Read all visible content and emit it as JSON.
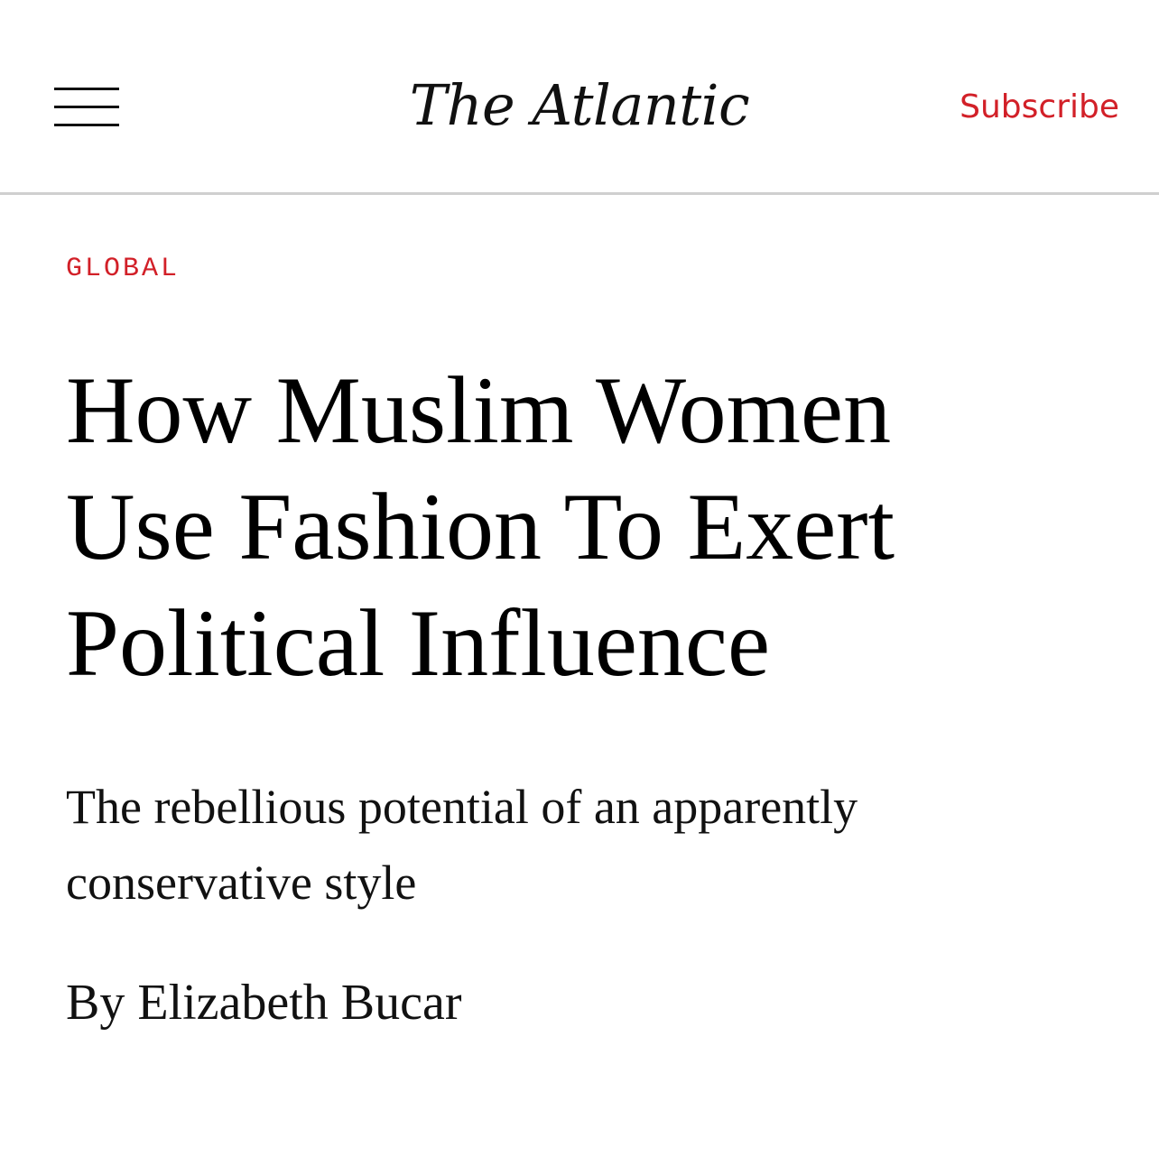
{
  "header": {
    "menu_icon": "hamburger-menu-icon",
    "logo_text": "The Atlantic",
    "subscribe_label": "Subscribe"
  },
  "article": {
    "section": "GLOBAL",
    "headline_lines": [
      "How Muslim Women",
      "Use Fashion To Exert",
      "Political Influence"
    ],
    "dek_lines": [
      "The rebellious potential of an apparently",
      "conservative style"
    ],
    "byline_prefix": "By",
    "author": "Elizabeth Bucar"
  },
  "colors": {
    "accent": "#d22028",
    "text": "#000000",
    "divider": "#cfcfcf",
    "background": "#ffffff"
  }
}
